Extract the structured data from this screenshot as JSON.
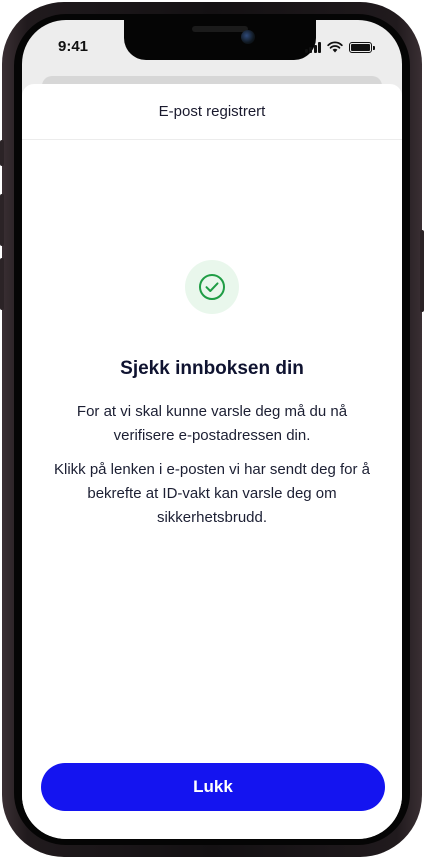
{
  "status_bar": {
    "time": "9:41"
  },
  "sheet": {
    "title": "E-post registrert",
    "heading": "Sjekk innboksen din",
    "paragraph_1": "For at vi skal kunne varsle deg må du nå verifisere e-postadressen din.",
    "paragraph_2": "Klikk på lenken i e-posten vi har sendt deg for å bekrefte at ID-vakt kan varsle deg om sikkerhetsbrudd.",
    "close_button_label": "Lukk",
    "success_icon": "check-circle-icon"
  },
  "colors": {
    "primary_button": "#1414f0",
    "success_green": "#1f9d45",
    "success_bg": "#e9f7ec",
    "text_dark": "#0f1330"
  }
}
